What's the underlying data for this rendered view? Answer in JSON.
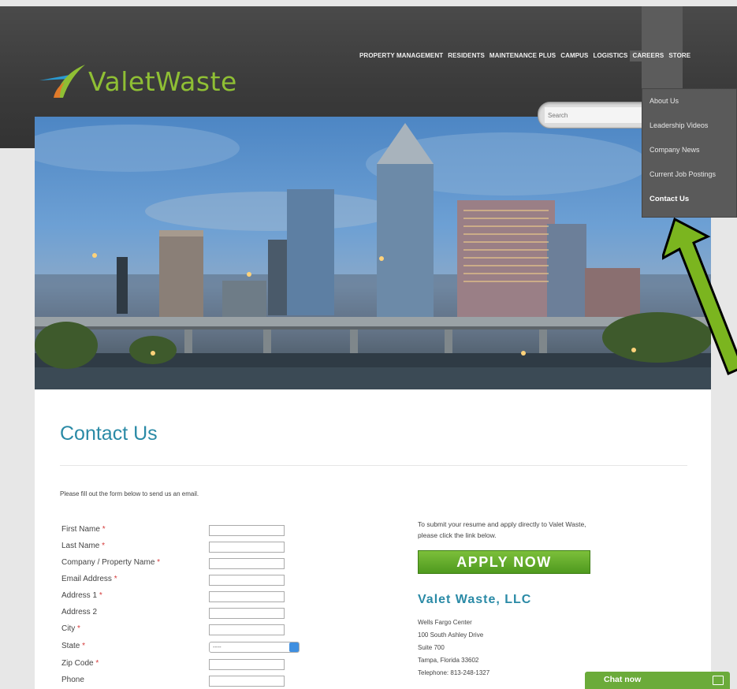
{
  "logo": {
    "text": "ValetWaste"
  },
  "nav": {
    "items": [
      "PROPERTY MANAGEMENT",
      "RESIDENTS",
      "MAINTENANCE PLUS",
      "CAMPUS",
      "LOGISTICS",
      "CAREERS",
      "STORE"
    ],
    "active": "CAREERS"
  },
  "search": {
    "placeholder": "Search"
  },
  "dropdown": {
    "items": [
      "About Us",
      "Leadership Videos",
      "Company News",
      "Current Job Postings",
      "Contact Us"
    ],
    "current": "Contact Us"
  },
  "page": {
    "title": "Contact Us",
    "intro": "Please fill out the form below to send us an email."
  },
  "form": {
    "fields": [
      {
        "label": "First Name",
        "required": true,
        "type": "text"
      },
      {
        "label": "Last Name",
        "required": true,
        "type": "text"
      },
      {
        "label": "Company / Property Name",
        "required": true,
        "type": "text"
      },
      {
        "label": "Email Address",
        "required": true,
        "type": "text"
      },
      {
        "label": "Address 1",
        "required": true,
        "type": "text"
      },
      {
        "label": "Address 2",
        "required": false,
        "type": "text"
      },
      {
        "label": "City",
        "required": true,
        "type": "text"
      },
      {
        "label": "State",
        "required": true,
        "type": "select",
        "value": "----"
      },
      {
        "label": "Zip Code",
        "required": true,
        "type": "text"
      },
      {
        "label": "Phone",
        "required": false,
        "type": "text"
      }
    ],
    "required_marker": "*"
  },
  "apply": {
    "text_line1": "To submit your resume and apply directly to Valet Waste,",
    "text_line2": "please click the link below.",
    "button_label": "APPLY NOW"
  },
  "company": {
    "name": "Valet Waste, LLC",
    "address_lines": [
      "Wells Fargo Center",
      "100 South Ashley Drive",
      "Suite 700",
      "Tampa, Florida 33602",
      "Telephone: 813-248-1327"
    ]
  },
  "chat": {
    "label": "Chat now"
  },
  "colors": {
    "accent_teal": "#2a8aa6",
    "brand_green": "#8fbf34",
    "button_green": "#5fa82a",
    "required_red": "#d43a3a",
    "annotation_arrow": "#7bb51f"
  }
}
